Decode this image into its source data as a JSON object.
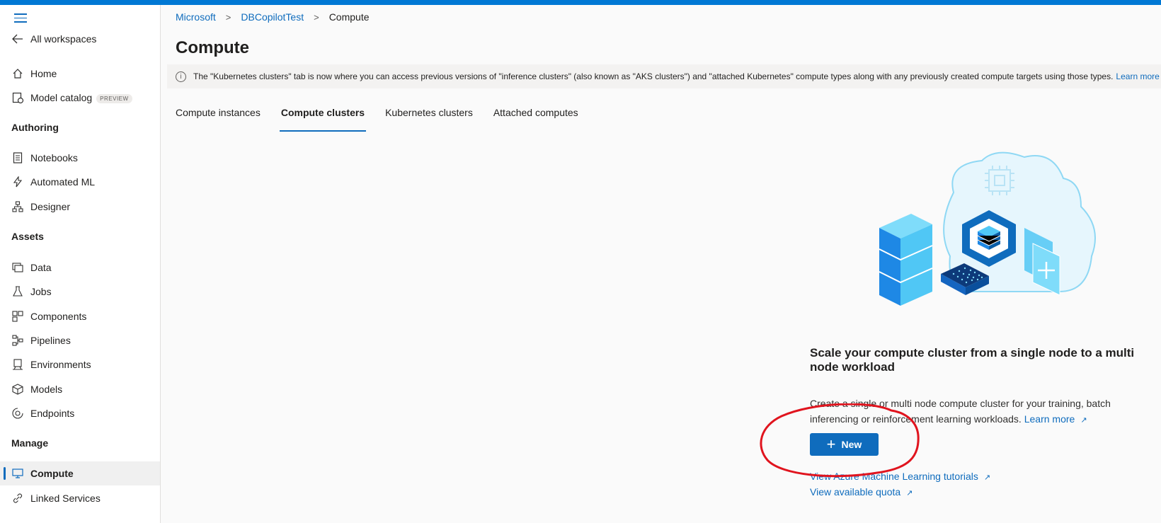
{
  "sidebar": {
    "back_label": "All workspaces",
    "home": "Home",
    "model_catalog": "Model catalog",
    "preview_badge": "PREVIEW",
    "authoring_header": "Authoring",
    "notebooks": "Notebooks",
    "automated_ml": "Automated ML",
    "designer": "Designer",
    "assets_header": "Assets",
    "data": "Data",
    "jobs": "Jobs",
    "components": "Components",
    "pipelines": "Pipelines",
    "environments": "Environments",
    "models": "Models",
    "endpoints": "Endpoints",
    "manage_header": "Manage",
    "compute": "Compute",
    "linked_services": "Linked Services"
  },
  "breadcrumb": {
    "items": [
      "Microsoft",
      "DBCopilotTest",
      "Compute"
    ]
  },
  "page": {
    "title": "Compute"
  },
  "banner": {
    "text": "The \"Kubernetes clusters\" tab is now where you can access previous versions of \"inference clusters\" (also known as \"AKS clusters\") and \"attached Kubernetes\" compute types along with any previously created compute targets using those types.",
    "learn_more": "Learn more abo"
  },
  "tabs": [
    "Compute instances",
    "Compute clusters",
    "Kubernetes clusters",
    "Attached computes"
  ],
  "empty_state": {
    "heading": "Scale your compute cluster from a single node to a multi node workload",
    "description": "Create a single or multi node compute cluster for your training, batch inferencing or reinforcement learning workloads.",
    "learn_more": "Learn more",
    "new_button": "New",
    "tutorials_link": "View Azure Machine Learning tutorials",
    "quota_link": "View available quota"
  },
  "colors": {
    "accent": "#0f6cbd",
    "top_bar": "#0078d4",
    "annotation": "#e0141e"
  }
}
